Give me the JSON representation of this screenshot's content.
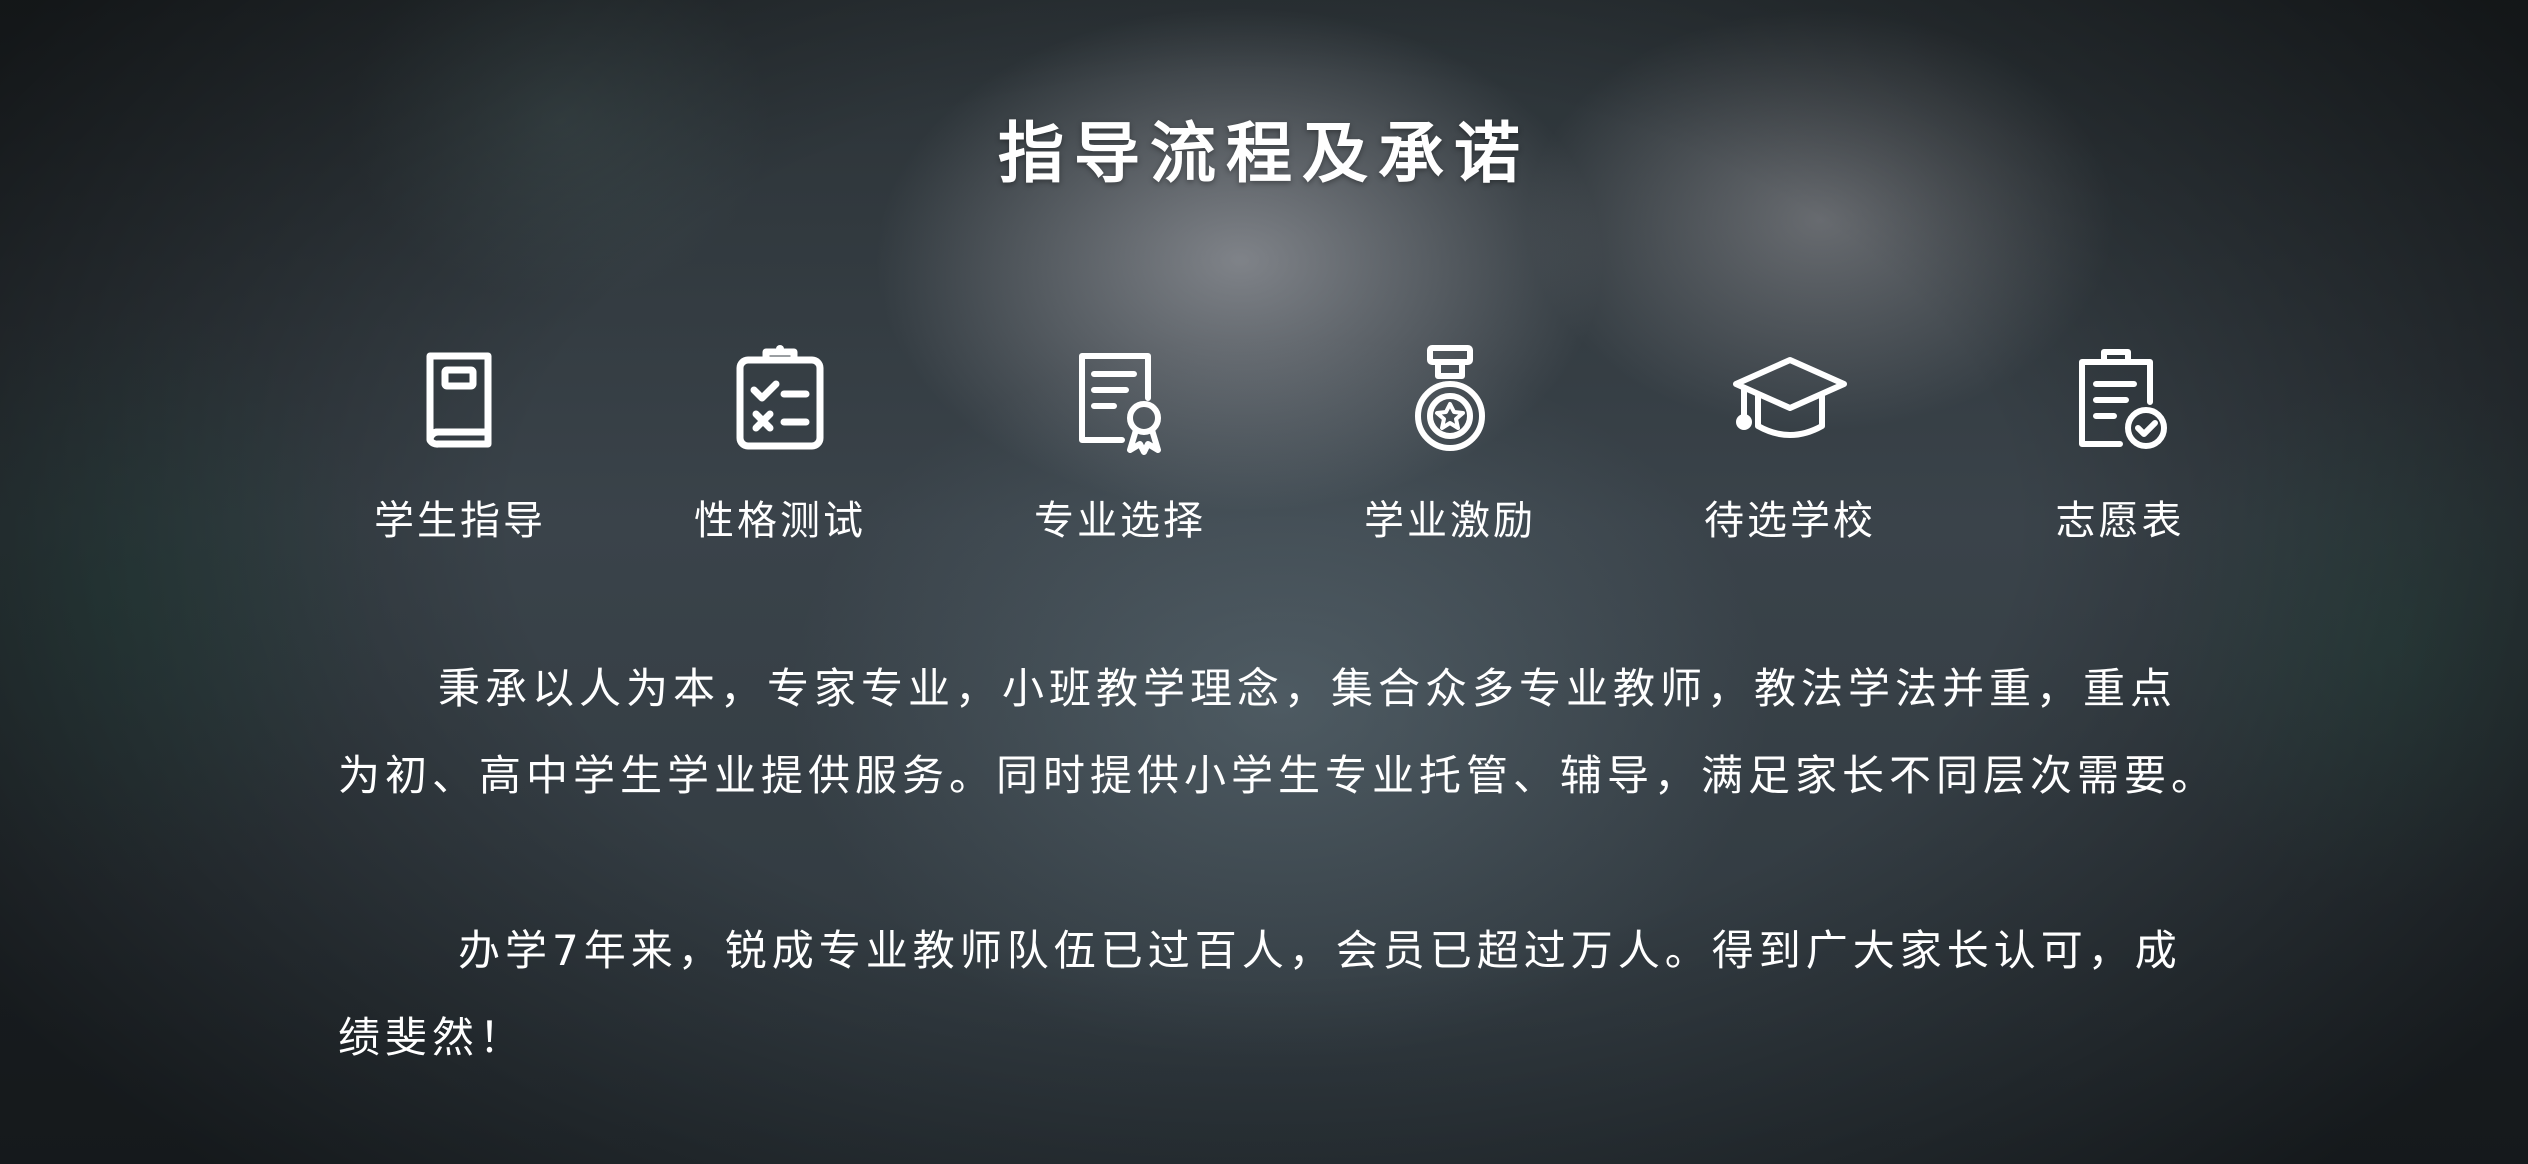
{
  "title": "指导流程及承诺",
  "steps": [
    {
      "label": "学生指导",
      "icon": "book-icon"
    },
    {
      "label": "性格测试",
      "icon": "checklist-clipboard-icon"
    },
    {
      "label": "专业选择",
      "icon": "certificate-document-icon"
    },
    {
      "label": "学业激励",
      "icon": "medal-icon"
    },
    {
      "label": "待选学校",
      "icon": "graduation-cap-icon"
    },
    {
      "label": "志愿表",
      "icon": "clipboard-check-icon"
    }
  ],
  "paragraphs": [
    "秉承以人为本，专家专业，小班教学理念，集合众多专业教师，教法学法并重，重点为初、高中学生学业提供服务。同时提供小学生专业托管、辅导，满足家长不同层次需要。",
    "办学7年来，锐成专业教师队伍已过百人，会员已超过万人。得到广大家长认可，成绩斐然！"
  ],
  "colors": {
    "text": "#ffffff",
    "background": "#2f383e"
  }
}
